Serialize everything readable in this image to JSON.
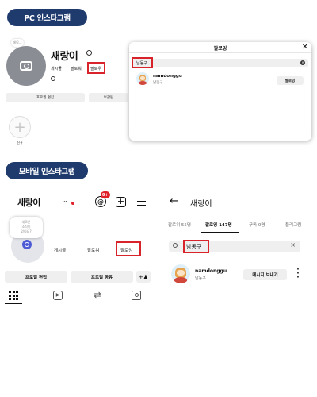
{
  "banners": {
    "pc": "PC 인스타그램",
    "mobile": "모바일 인스타그램"
  },
  "pc_profile": {
    "note": "메모...",
    "username": "새랑이",
    "stats": {
      "posts": "게시물",
      "followers": "팔로워",
      "following": "팔로우"
    },
    "buttons": {
      "edit": "프로필 편집",
      "archive": "보관된"
    },
    "highlight_label": "신규"
  },
  "pc_modal": {
    "title": "팔로잉",
    "close": "✕",
    "search_value": "남동구",
    "result": {
      "username": "namdonggu",
      "subtitle": "남동구",
      "button": "팔로잉"
    }
  },
  "mobile_profile": {
    "username": "새랑이",
    "badge": "9+",
    "note_bubble": [
      "새로운",
      "소식이",
      "있나요?"
    ],
    "stats": {
      "posts": "게시물",
      "followers": "팔로워",
      "following": "팔로잉"
    },
    "buttons": {
      "edit": "프로필 편집",
      "share": "프로필 공유"
    }
  },
  "mobile_following": {
    "title": "새랑이",
    "tabs": [
      "팔로워 55명",
      "팔로잉 147명",
      "구독 0명",
      "플러그림"
    ],
    "active_tab": 1,
    "search_value": "남동구",
    "result": {
      "username": "namdonggu",
      "subtitle": "남동구",
      "button": "메시지 보내기"
    }
  },
  "colors": {
    "banner": "#1f3b6e",
    "highlight_red": "#d8232a",
    "notification_red": "#e0222a"
  },
  "icons": [
    "camera-icon",
    "gear-icon",
    "threads-icon",
    "plus-icon",
    "close-icon",
    "clear-icon",
    "chevron-down-icon",
    "add-post-icon",
    "menu-icon",
    "add-user-icon",
    "grid-icon",
    "reels-icon",
    "reposts-icon",
    "tagged-icon",
    "back-arrow-icon",
    "search-icon",
    "more-icon"
  ]
}
